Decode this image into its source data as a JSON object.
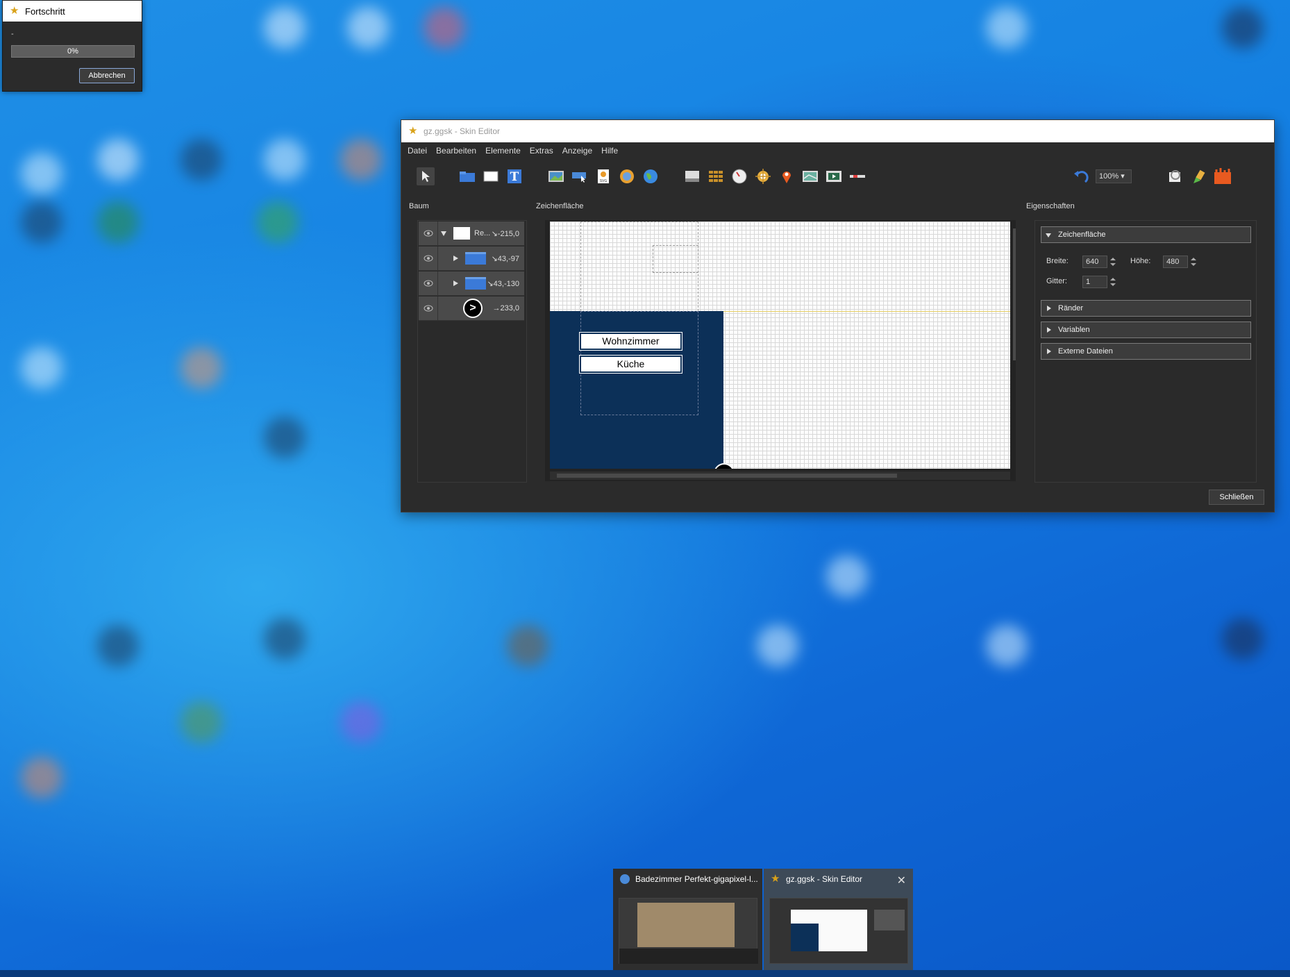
{
  "progress_dialog": {
    "title": "Fortschritt",
    "status": "-",
    "percent": "0%",
    "cancel_label": "Abbrechen"
  },
  "editor": {
    "title": "gz.ggsk - Skin Editor",
    "menu": [
      "Datei",
      "Bearbeiten",
      "Elemente",
      "Extras",
      "Anzeige",
      "Hilfe"
    ],
    "zoom": "100%",
    "panels": {
      "tree": "Baum",
      "canvas": "Zeichenfläche",
      "properties": "Eigenschaften"
    },
    "tree_rows": [
      {
        "label": "Re...",
        "coord": "↘-215,0"
      },
      {
        "label": "",
        "coord": "↘43,-97"
      },
      {
        "label": "",
        "coord": "↘43,-130"
      },
      {
        "label": "",
        "coord": "→233,0"
      }
    ],
    "canvas_buttons": [
      "Wohnzimmer",
      "Küche"
    ],
    "properties": {
      "section_canvas": "Zeichenfläche",
      "width_label": "Breite:",
      "width_value": "640",
      "height_label": "Höhe:",
      "height_value": "480",
      "grid_label": "Gitter:",
      "grid_value": "1",
      "sections": [
        "Ränder",
        "Variablen",
        "Externe Dateien"
      ]
    },
    "close_label": "Schließen"
  },
  "taskbar": {
    "previews": [
      {
        "title": "Badezimmer Perfekt-gigapixel-l..."
      },
      {
        "title": "gz.ggsk - Skin Editor"
      }
    ]
  },
  "colors": {
    "navy": "#0c3058",
    "editor_bg": "#2b2b2b",
    "accent_blue": "#3b7ad8"
  }
}
